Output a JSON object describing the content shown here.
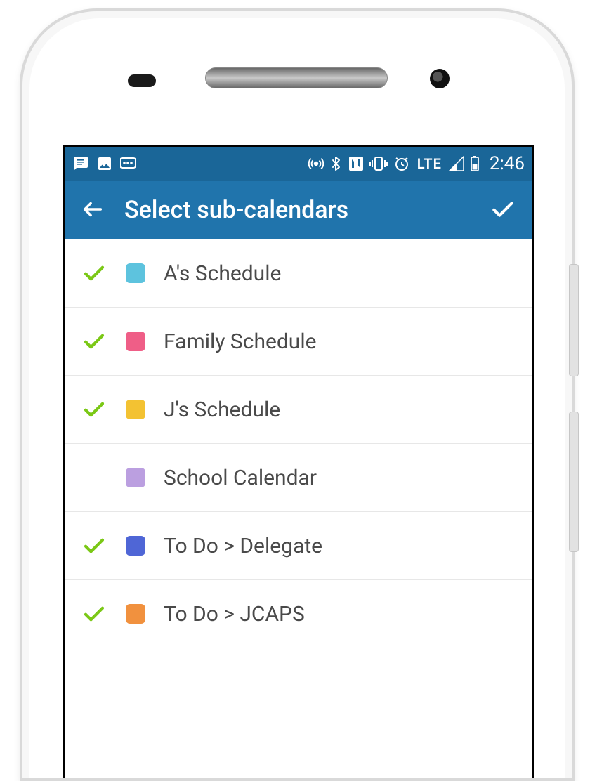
{
  "status_bar": {
    "network_label": "LTE",
    "time": "2:46"
  },
  "app_bar": {
    "title": "Select sub-calendars"
  },
  "calendars": [
    {
      "selected": true,
      "color": "#5dc3de",
      "label": "A's Schedule"
    },
    {
      "selected": true,
      "color": "#ef5e87",
      "label": "Family Schedule"
    },
    {
      "selected": true,
      "color": "#f3c232",
      "label": "J's Schedule"
    },
    {
      "selected": false,
      "color": "#bb9fe0",
      "label": "School Calendar"
    },
    {
      "selected": true,
      "color": "#4f66d6",
      "label": "To Do > Delegate"
    },
    {
      "selected": true,
      "color": "#f1913e",
      "label": "To Do > JCAPS"
    }
  ]
}
